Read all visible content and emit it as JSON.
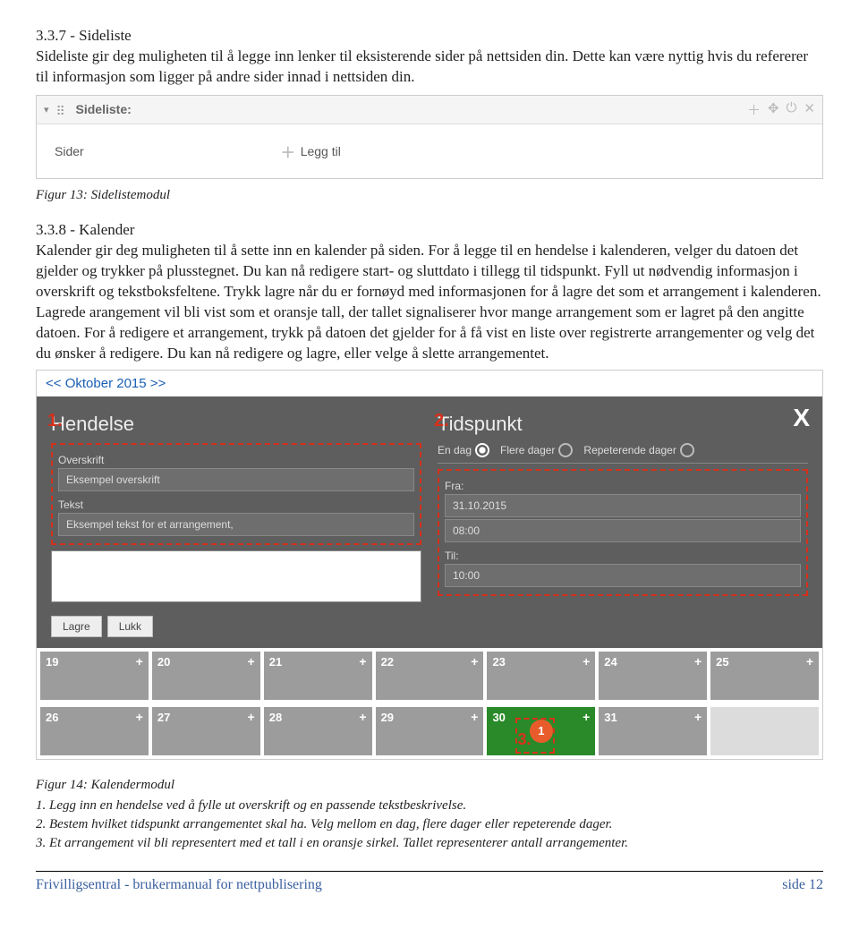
{
  "sec1": {
    "heading": "3.3.7 - Sideliste",
    "body": "Sideliste gir deg muligheten til å legge inn lenker til eksisterende sider på nettsiden din. Dette kan være nyttig hvis du refererer til informasjon som ligger på andre sider innad i nettsiden din."
  },
  "sideliste": {
    "title": "Sideliste:",
    "lbl": "Sider",
    "add": "Legg til"
  },
  "fig13": "Figur 13: Sidelistemodul",
  "sec2": {
    "heading": "3.3.8 - Kalender",
    "body": "Kalender gir deg muligheten til å sette inn en kalender på siden. For å legge til en hendelse i kalenderen, velger du datoen det gjelder og trykker på plusstegnet. Du kan nå redigere start- og sluttdato i tillegg til tidspunkt. Fyll ut nødvendig informasjon i overskrift og tekstboksfeltene. Trykk lagre når du er fornøyd med informasjonen for å lagre det som et arrangement i kalenderen. Lagrede arangement vil bli vist som et oransje tall, der tallet signaliserer hvor mange arrangement som er lagret på den angitte datoen. For å redigere et arrangement, trykk på datoen det gjelder for å få vist en liste over registrerte arrangementer og velg det du ønsker å redigere. Du kan nå redigere og lagre, eller velge å slette arrangementet."
  },
  "calendar": {
    "nav": {
      "prev": "<<",
      "month": "Oktober 2015",
      "next": ">>"
    },
    "hendelse": {
      "num": "1.",
      "title": "Hendelse",
      "lbl_over": "Overskrift",
      "val_over": "Eksempel overskrift",
      "lbl_tekst": "Tekst",
      "val_tekst": "Eksempel tekst for et arrangement,"
    },
    "tidspunkt": {
      "num": "2.",
      "title": "Tidspunkt",
      "opt1": "En dag",
      "opt2": "Flere dager",
      "opt3": "Repeterende dager",
      "lbl_fra": "Fra:",
      "val_date": "31.10.2015",
      "val_from": "08:00",
      "lbl_til": "Til:",
      "val_to": "10:00"
    },
    "btn_save": "Lagre",
    "btn_close": "Lukk",
    "row1": [
      "19",
      "20",
      "21",
      "22",
      "23",
      "24",
      "25"
    ],
    "row2": [
      "26",
      "27",
      "28",
      "29",
      "30",
      "31",
      ""
    ],
    "badge_num3": "3.",
    "badge_count": "1"
  },
  "fig14": {
    "title": "Figur 14: Kalendermodul",
    "l1": "1. Legg inn en hendelse ved å fylle ut overskrift og en passende tekstbeskrivelse.",
    "l2": "2. Bestem hvilket tidspunkt arrangementet skal ha. Velg mellom en dag, flere dager eller repeterende dager.",
    "l3": "3. Et arrangement vil bli representert med et tall i en oransje sirkel. Tallet representerer antall arrangementer."
  },
  "footer": {
    "left": "Frivilligsentral - brukermanual for nettpublisering",
    "right": "side 12"
  }
}
